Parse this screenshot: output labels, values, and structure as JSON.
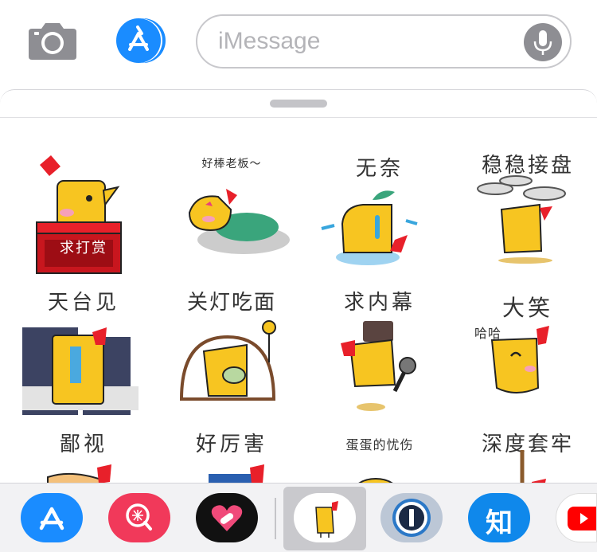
{
  "input": {
    "placeholder": "iMessage"
  },
  "stickers": [
    {
      "caption": "求打赏"
    },
    {
      "caption": "好棒老板～"
    },
    {
      "caption": "无奈"
    },
    {
      "caption": "稳稳接盘"
    },
    {
      "caption": "天台见"
    },
    {
      "caption": "关灯吃面"
    },
    {
      "caption": "求内幕"
    },
    {
      "caption": "大笑"
    },
    {
      "caption": "鄙视"
    },
    {
      "caption": "好厉害"
    },
    {
      "caption": "蛋蛋的忧伤"
    },
    {
      "caption": "深度套牢"
    }
  ],
  "misc": {
    "laugh": "哈哈",
    "zhihu": "知"
  },
  "colors": {
    "ios_blue": "#1a8cff",
    "chick_yellow": "#f7c521",
    "chick_red": "#e8202a",
    "tray_bg": "#f2f2f4"
  }
}
